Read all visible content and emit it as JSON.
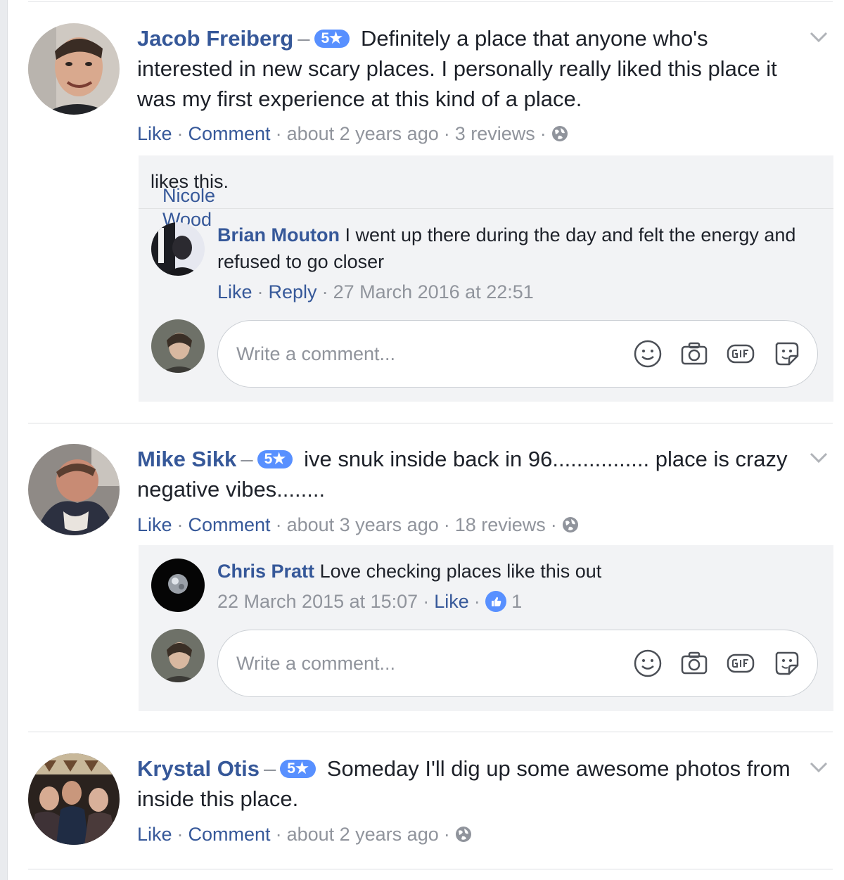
{
  "reviews": [
    {
      "author": "Jacob Freiberg",
      "dash": "–",
      "rating": "5★",
      "text": "Definitely a place that anyone who's interested in new scary places. I personally really liked this place it was my first experience at this kind of a place.",
      "actions": {
        "like": "Like",
        "comment": "Comment"
      },
      "time": "about 2 years ago",
      "reviews_count": "3 reviews",
      "likes": {
        "name": "Nicole Wood",
        "suffix": "likes this."
      },
      "replies": [
        {
          "author": "Brian Mouton",
          "text": "I went up there during the day and felt the energy and refused to go closer",
          "like": "Like",
          "reply": "Reply",
          "time": "27 March 2016 at 22:51"
        }
      ],
      "composer": {
        "placeholder": "Write a comment..."
      }
    },
    {
      "author": "Mike Sikk",
      "dash": "–",
      "rating": "5★",
      "text": "ive snuk inside back in 96................ place is crazy negative vibes........",
      "actions": {
        "like": "Like",
        "comment": "Comment"
      },
      "time": "about 3 years ago",
      "reviews_count": "18 reviews",
      "replies": [
        {
          "author": "Chris Pratt",
          "text": "Love checking places like this out",
          "time": "22 March 2015 at 15:07",
          "like": "Like",
          "reaction_count": "1"
        }
      ],
      "composer": {
        "placeholder": "Write a comment..."
      }
    },
    {
      "author": "Krystal Otis",
      "dash": "–",
      "rating": "5★",
      "text": "Someday I'll dig up some awesome photos from inside this place.",
      "actions": {
        "like": "Like",
        "comment": "Comment"
      },
      "time": "about 2 years ago"
    }
  ],
  "separator": "·",
  "colors": {
    "link": "#365899",
    "meta": "#90949c",
    "rating_badge": "#5890ff",
    "thread_bg": "#f2f3f5"
  },
  "icons": [
    "chevron-down-icon",
    "globe-icon",
    "emoji-icon",
    "camera-icon",
    "gif-icon",
    "sticker-icon",
    "like-reaction-icon"
  ]
}
